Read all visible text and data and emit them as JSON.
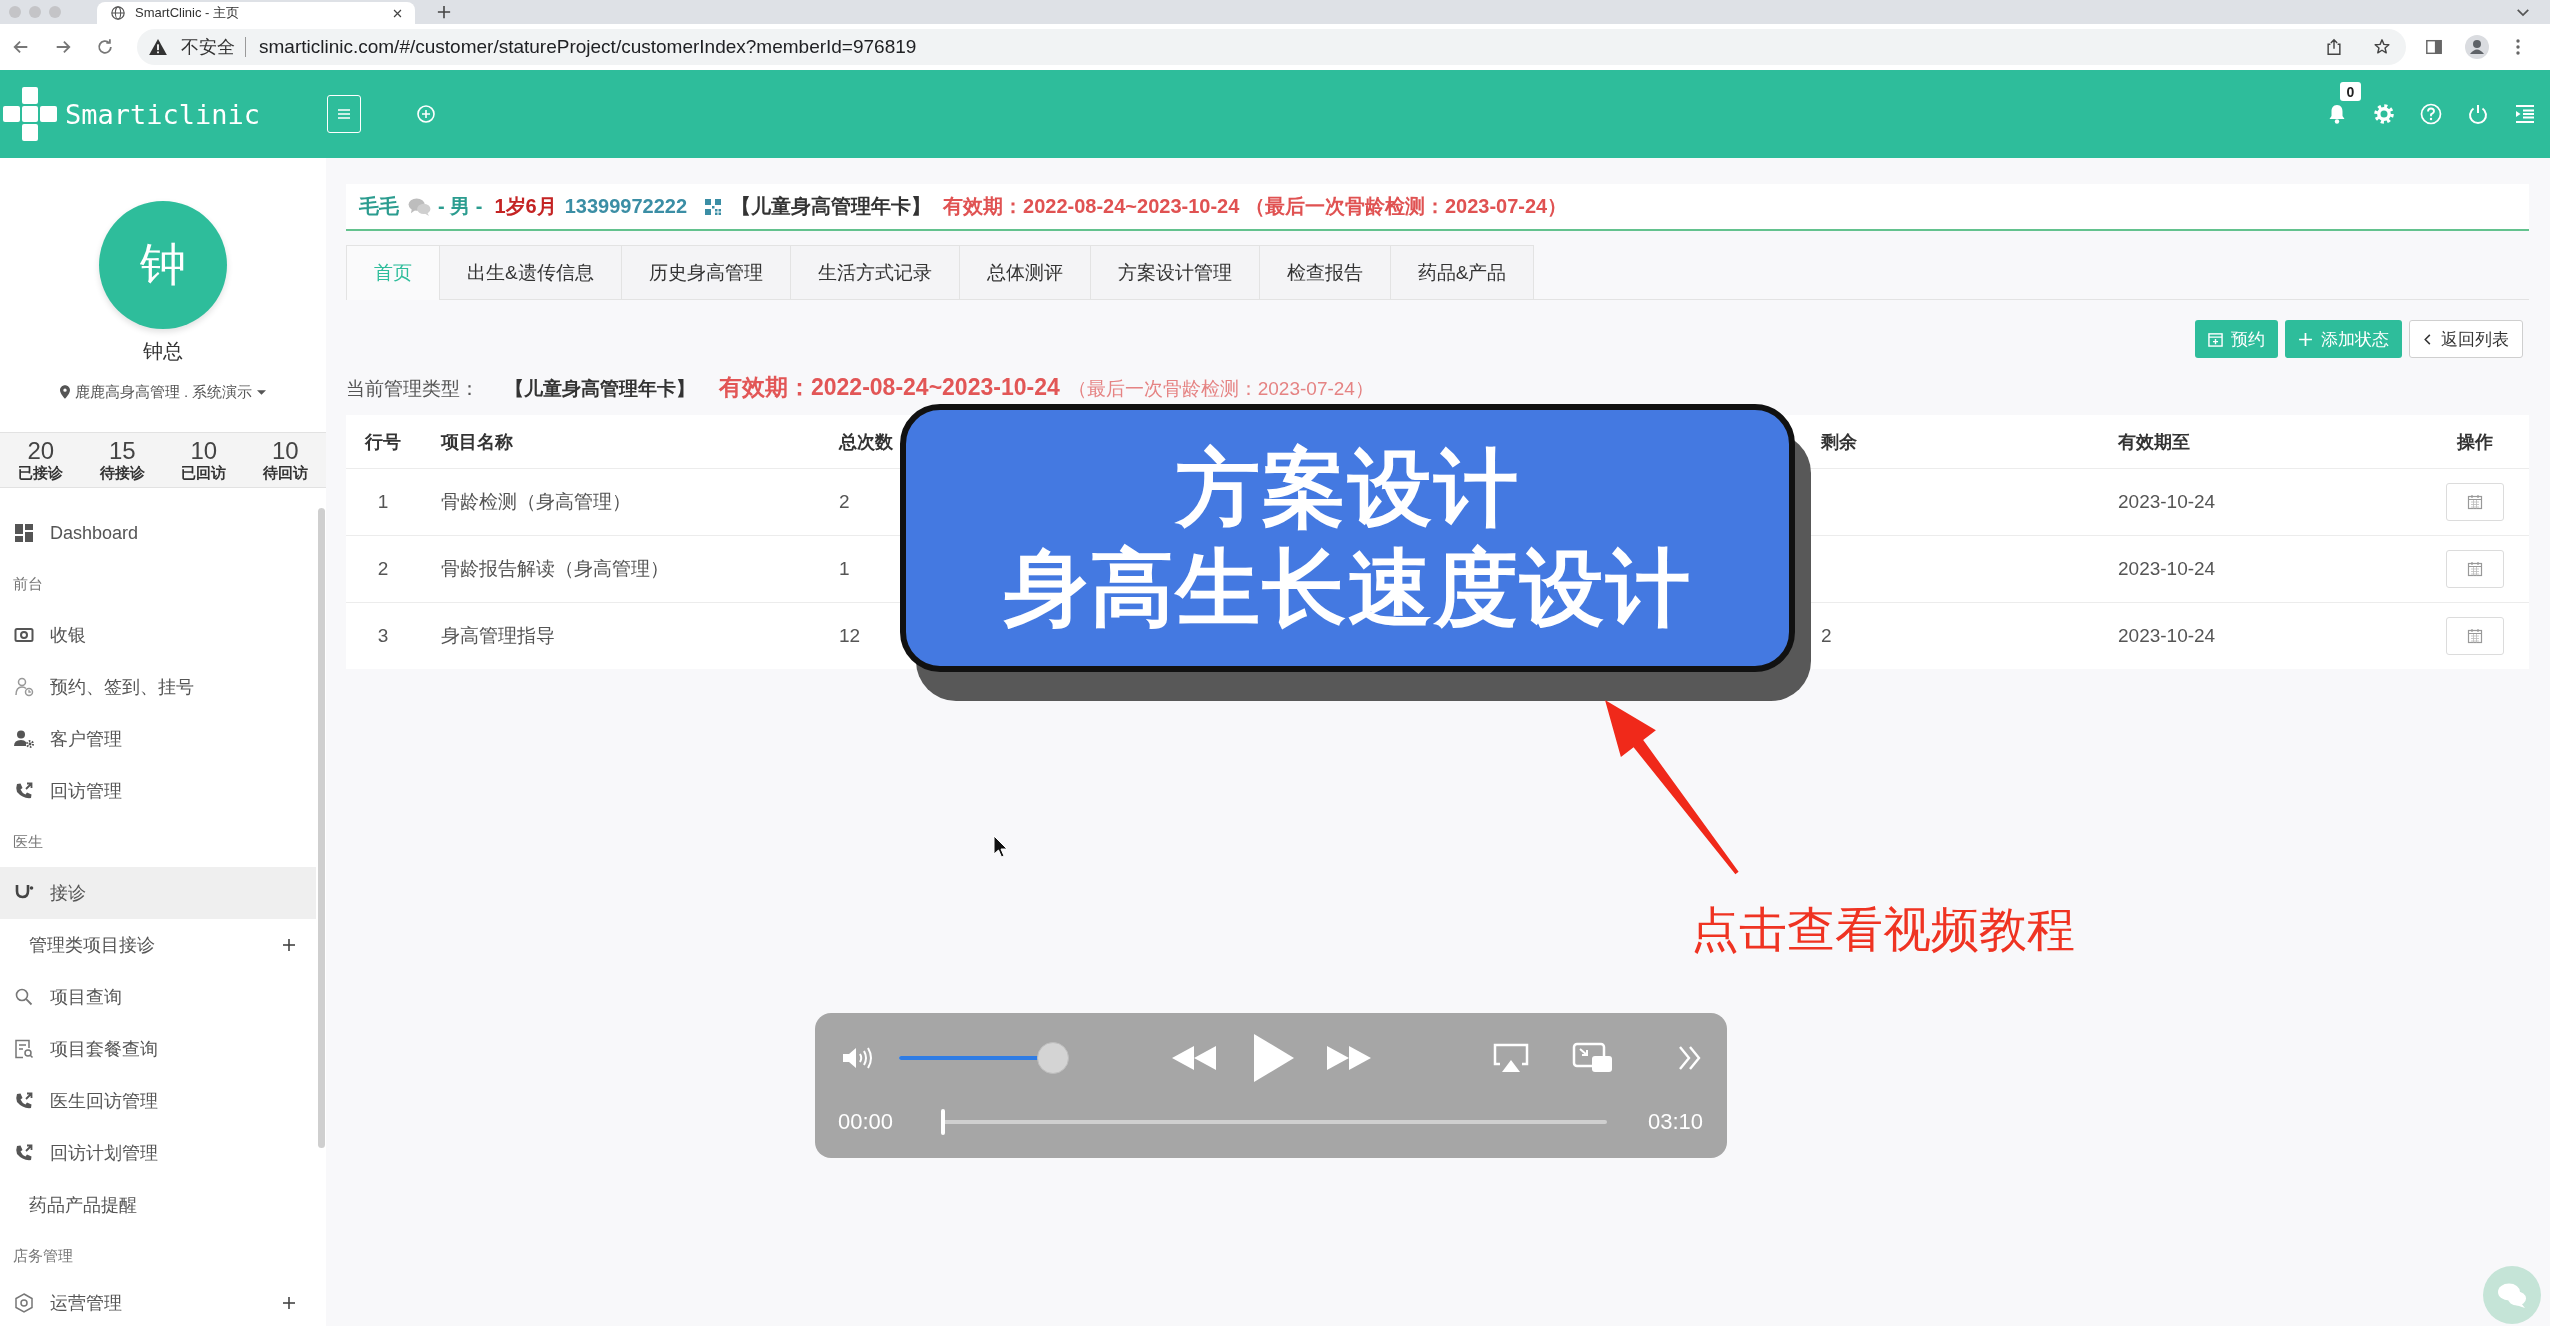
{
  "browser": {
    "tab_title": "SmartClinic - 主页",
    "security_label": "不安全",
    "url": "smarticlinic.com/#/customer/statureProject/customerIndex?memberId=976819"
  },
  "header": {
    "brand": "Smarticlinic",
    "notification_count": "0"
  },
  "sidebar": {
    "avatar_letter": "钟",
    "user_name": "钟总",
    "organization": "鹿鹿高身高管理 . 系统演示",
    "stats": [
      {
        "value": "20",
        "label": "已接诊"
      },
      {
        "value": "15",
        "label": "待接诊"
      },
      {
        "value": "10",
        "label": "已回访"
      },
      {
        "value": "10",
        "label": "待回访"
      }
    ],
    "menu": [
      {
        "kind": "item",
        "label": "Dashboard",
        "selected": false
      },
      {
        "kind": "section",
        "label": "前台"
      },
      {
        "kind": "item",
        "label": "收银",
        "selected": false
      },
      {
        "kind": "item",
        "label": "预约、签到、挂号",
        "selected": false
      },
      {
        "kind": "item",
        "label": "客户管理",
        "selected": false
      },
      {
        "kind": "item",
        "label": "回访管理",
        "selected": false
      },
      {
        "kind": "section",
        "label": "医生"
      },
      {
        "kind": "item",
        "label": "接诊",
        "selected": true
      },
      {
        "kind": "sub",
        "label": "管理类项目接诊",
        "selected": false,
        "expanded": false
      },
      {
        "kind": "item",
        "label": "项目查询",
        "selected": false
      },
      {
        "kind": "item",
        "label": "项目套餐查询",
        "selected": false
      },
      {
        "kind": "item",
        "label": "医生回访管理",
        "selected": false
      },
      {
        "kind": "item",
        "label": "回访计划管理",
        "selected": false
      },
      {
        "kind": "sub",
        "label": "药品产品提醒",
        "selected": false
      },
      {
        "kind": "section",
        "label": "店务管理"
      },
      {
        "kind": "item",
        "label": "运营管理",
        "selected": false,
        "expanded": false
      }
    ]
  },
  "patient": {
    "name": "毛毛",
    "gender": "- 男 -",
    "age": "1岁6月",
    "phone": "13399972222",
    "card": "【儿童身高管理年卡】",
    "validity": "有效期：2022-08-24~2023-10-24 （最后一次骨龄检测：2023-07-24）"
  },
  "tabs": [
    {
      "label": "首页",
      "selected": true
    },
    {
      "label": "出生&遗传信息",
      "selected": false
    },
    {
      "label": "历史身高管理",
      "selected": false
    },
    {
      "label": "生活方式记录",
      "selected": false
    },
    {
      "label": "总体测评",
      "selected": false
    },
    {
      "label": "方案设计管理",
      "selected": false
    },
    {
      "label": "检查报告",
      "selected": false
    },
    {
      "label": "药品&产品",
      "selected": false
    }
  ],
  "actions": [
    {
      "label": "预约",
      "kind": "primary"
    },
    {
      "label": "添加状态",
      "kind": "primary"
    },
    {
      "label": "返回列表",
      "kind": "default"
    }
  ],
  "management": {
    "label": "当前管理类型：",
    "card": "【儿童身高管理年卡】",
    "validity": "有效期：2022-08-24~2023-10-24",
    "last_check": "（最后一次骨龄检测：2023-07-24）"
  },
  "table": {
    "columns": [
      "行号",
      "项目名称",
      "总次数",
      "剩余",
      "有效期至",
      "操作"
    ],
    "rows": [
      {
        "index": "1",
        "name": "骨龄检测（身高管理）",
        "total": "2",
        "valid_until": "2023-10-24"
      },
      {
        "index": "2",
        "name": "骨龄报告解读（身高管理）",
        "total": "1",
        "valid_until": "2023-10-24"
      },
      {
        "index": "3",
        "name": "身高管理指导",
        "total": "12",
        "remaining": "2",
        "valid_until": "2023-10-24"
      }
    ]
  },
  "tutorial": {
    "title_lines": [
      "方案设计",
      "身高生长速度设计"
    ],
    "hint": "点击查看视频教程"
  },
  "player": {
    "volume": {
      "level": 0.95
    },
    "current_time": "00:00",
    "progress": {
      "level": 0
    },
    "duration": "03:10"
  }
}
